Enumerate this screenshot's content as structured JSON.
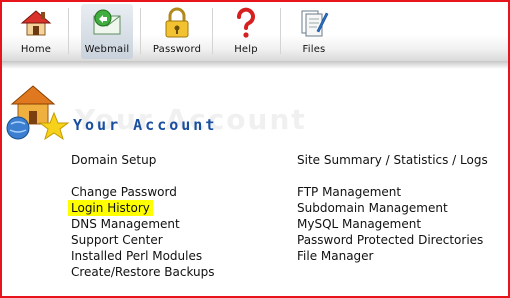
{
  "toolbar": {
    "items": [
      {
        "label": "Home",
        "icon": "house-icon"
      },
      {
        "label": "Webmail",
        "icon": "mail-icon"
      },
      {
        "label": "Password",
        "icon": "padlock-icon"
      },
      {
        "label": "Help",
        "icon": "question-icon"
      },
      {
        "label": "Files",
        "icon": "files-icon"
      }
    ],
    "active": "Webmail"
  },
  "section": {
    "title": "Your Account",
    "watermark": "Your Account",
    "icon": "account-house-star-globe-icon"
  },
  "links": {
    "left": [
      "Domain Setup",
      "Change Password",
      "Login History",
      "DNS Management",
      "Support Center",
      "Installed Perl Modules",
      "Create/Restore Backups"
    ],
    "right": [
      "Site Summary / Statistics / Logs",
      "FTP Management",
      "Subdomain Management",
      "MySQL Management",
      "Password Protected Directories",
      "File Manager"
    ],
    "highlighted": "Login History"
  },
  "colors": {
    "border": "#e8141b",
    "title": "#1a4fa0",
    "highlight": "#ffff00"
  }
}
